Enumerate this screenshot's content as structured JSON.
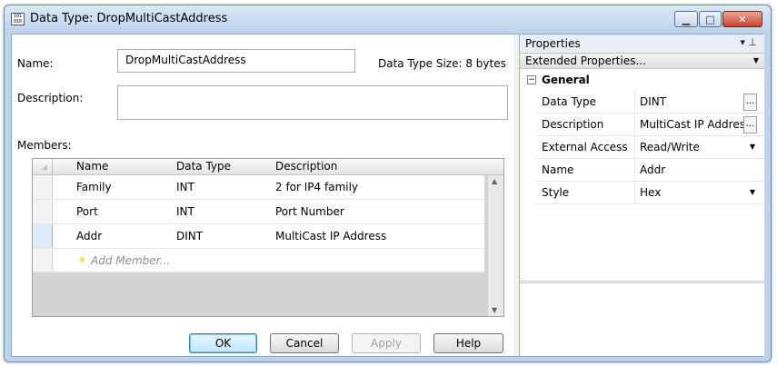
{
  "window": {
    "title": "Data Type: DropMultiCastAddress",
    "icon_text": "101 010",
    "minimize_glyph": "▁",
    "maximize_glyph": "□",
    "close_glyph": "✕"
  },
  "editor": {
    "name_label": "Name:",
    "name_value": "DropMultiCastAddress",
    "size_label": "Data Type Size: 8 bytes",
    "description_label": "Description:",
    "description_value": "",
    "members_label": "Members:",
    "columns": [
      "Name",
      "Data Type",
      "Description"
    ],
    "rows": [
      {
        "name": "Family",
        "type": "INT",
        "description": "2 for IP4 family"
      },
      {
        "name": "Port",
        "type": "INT",
        "description": "Port Number"
      },
      {
        "name": "Addr",
        "type": "DINT",
        "description": "MultiCast IP Address"
      }
    ],
    "add_member": "Add Member...",
    "buttons": {
      "ok": "OK",
      "cancel": "Cancel",
      "apply": "Apply",
      "help": "Help"
    }
  },
  "properties": {
    "title": "Properties",
    "pin_glyph": "▾  ⊥",
    "combo": "Extended Properties...",
    "category": "General",
    "rows": [
      {
        "key": "Data Type",
        "value": "DINT"
      },
      {
        "key": "Description",
        "value": "MultiCast IP Address"
      },
      {
        "key": "External Access",
        "value": "Read/Write"
      },
      {
        "key": "Name",
        "value": "Addr"
      },
      {
        "key": "Style",
        "value": "Hex"
      }
    ]
  }
}
